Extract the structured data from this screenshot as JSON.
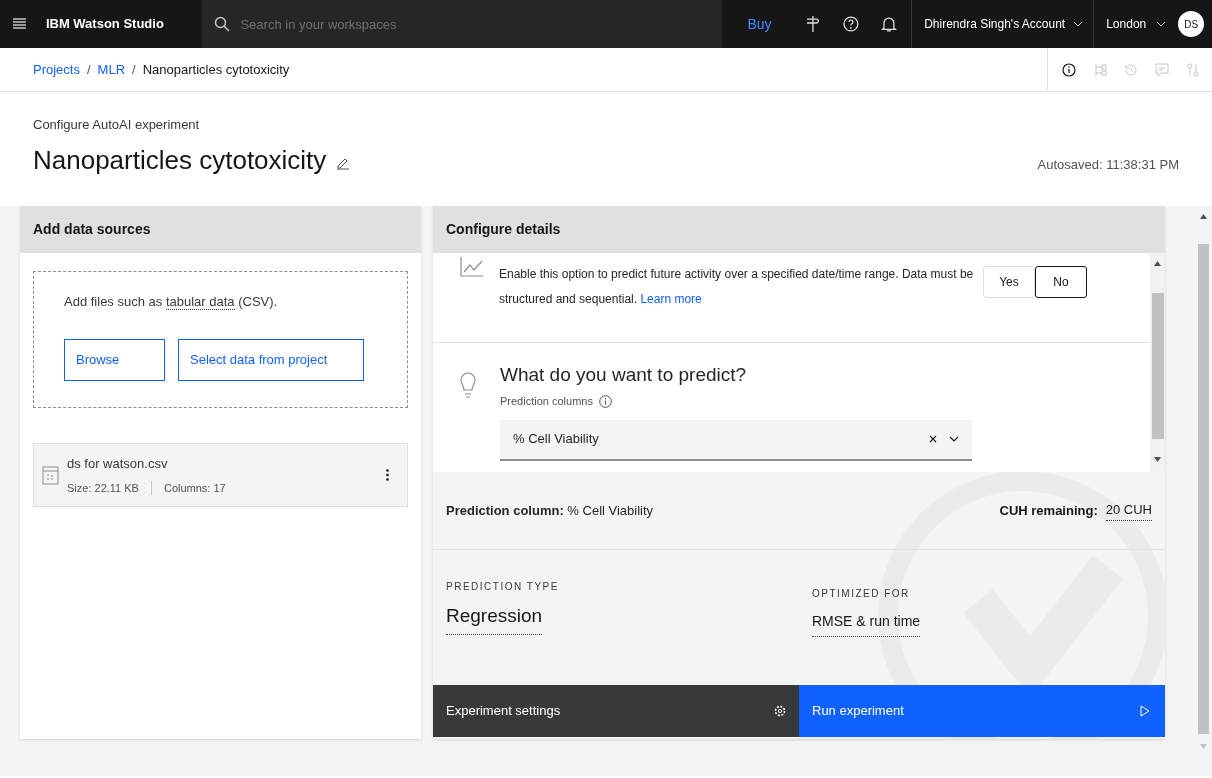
{
  "header": {
    "brand": "IBM Watson Studio",
    "search_placeholder": "Search in your workspaces",
    "buy": "Buy",
    "account": "Dhirendra Singh's Account",
    "region": "London",
    "avatar": "DS"
  },
  "breadcrumb_separators": [
    "/",
    "/"
  ],
  "breadcrumbs": [
    {
      "label": "Projects",
      "link": true
    },
    {
      "label": "MLR",
      "link": true
    },
    {
      "label": "Nanoparticles cytotoxicity",
      "link": false
    }
  ],
  "page": {
    "subtitle": "Configure AutoAI experiment",
    "title": "Nanoparticles cytotoxicity",
    "autosaved": "Autosaved: 11:38:31 PM"
  },
  "data_sources": {
    "title": "Add data sources",
    "hint_before": "Add files such as",
    "hint_term": "tabular data",
    "hint_after": "(CSV).",
    "buttons": [
      "Browse",
      "Select data from project"
    ],
    "file": {
      "name": "ds for watson.csv",
      "size": "Size: 22.11 KB",
      "columns": "Columns: 17"
    }
  },
  "configure": {
    "title": "Configure details",
    "forecast": {
      "description": "Enable this option to predict future activity over a specified date/time range. Data must be structured and sequential.",
      "link": "Learn more",
      "options": [
        {
          "label": "Yes",
          "selected": false
        },
        {
          "label": "No",
          "selected": true
        }
      ]
    },
    "predict": {
      "heading": "What do you want to predict?",
      "label": "Prediction columns",
      "value": "% Cell Viability"
    },
    "summary": {
      "prediction_label": "Prediction column:",
      "prediction_value": "% Cell Viability",
      "cuh_label": "CUH remaining:",
      "cuh_value": "20 CUH"
    },
    "prediction_type": {
      "label": "PREDICTION TYPE",
      "value": "Regression"
    },
    "optimized_for": {
      "label": "OPTIMIZED FOR",
      "value": "RMSE & run time"
    },
    "settings_button": "Experiment settings",
    "run_button": "Run experiment"
  }
}
